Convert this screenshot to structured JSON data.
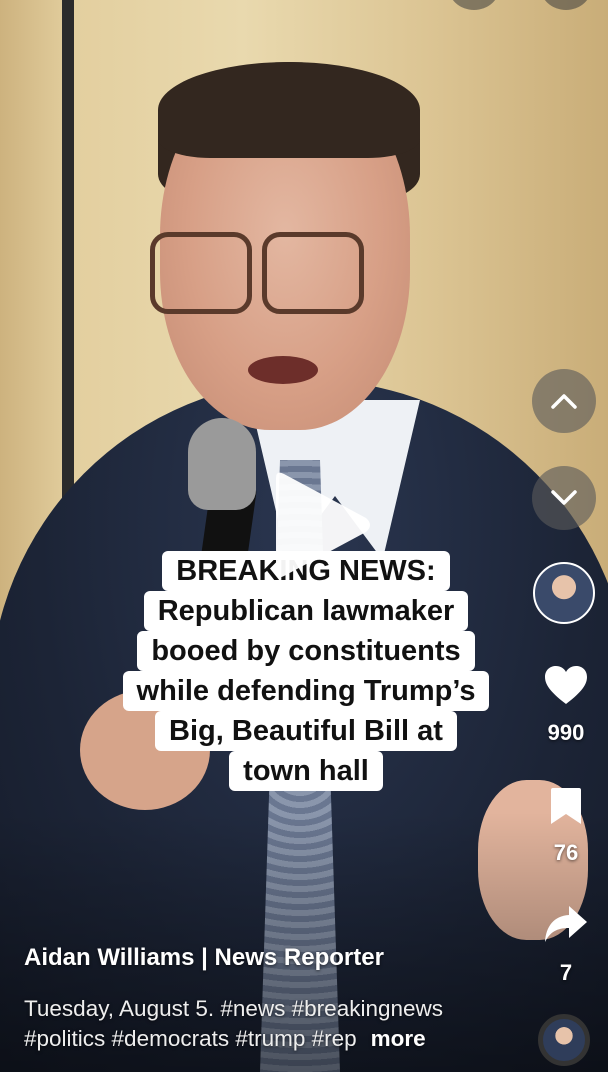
{
  "caption": {
    "lines": [
      "BREAKING NEWS:",
      "Republican lawmaker",
      "booed by constituents",
      "while defending Trump’s",
      "Big, Beautiful Bill at",
      "town hall"
    ]
  },
  "rail": {
    "likes": "990",
    "saves": "76",
    "shares": "7"
  },
  "post": {
    "author": "Aidan Williams | News Reporter",
    "description_line1": "Tuesday, August 5. #news #breakingnews",
    "description_line2": "#politics #democrats #trump #rep",
    "more_label": "more"
  },
  "icons": {
    "play": "play-icon",
    "up": "chevron-up-icon",
    "down": "chevron-down-icon",
    "like": "heart-icon",
    "save": "bookmark-icon",
    "share": "share-arrow-icon"
  },
  "colors": {
    "accent_white": "#ffffff",
    "nav_button_bg": "#5a5a5a"
  }
}
